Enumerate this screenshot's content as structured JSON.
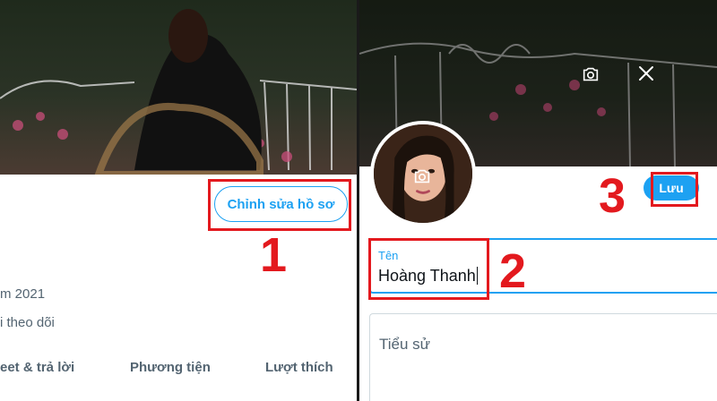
{
  "left_panel": {
    "edit_profile_label": "Chỉnh sửa hồ sơ",
    "joined_text": "m 2021",
    "follow_text": "i theo dõi",
    "tabs": [
      "eet & trả lời",
      "Phương tiện",
      "Lượt thích"
    ]
  },
  "right_panel": {
    "save_label": "Lưu",
    "name_field": {
      "label": "Tên",
      "value": "Hoàng Thanh"
    },
    "bio_field": {
      "label": "Tiểu sử"
    }
  },
  "annotations": {
    "step_1": "1",
    "step_2": "2",
    "step_3": "3"
  },
  "colors": {
    "accent": "#1da1f2",
    "annotation_red": "#e3191e",
    "text_secondary": "#536471"
  },
  "icons": {
    "cover_camera": "camera-icon",
    "cover_close": "close-icon",
    "avatar_camera": "camera-icon"
  }
}
